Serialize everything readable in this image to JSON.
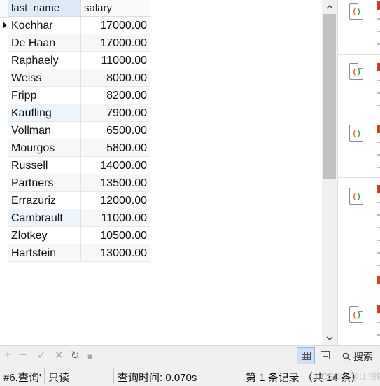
{
  "grid": {
    "columns": [
      "last_name",
      "salary"
    ],
    "rows": [
      [
        "Kochhar",
        "17000.00"
      ],
      [
        "De Haan",
        "17000.00"
      ],
      [
        "Raphaely",
        "11000.00"
      ],
      [
        "Weiss",
        "8000.00"
      ],
      [
        "Fripp",
        "8200.00"
      ],
      [
        "Kaufling",
        "7900.00"
      ],
      [
        "Vollman",
        "6500.00"
      ],
      [
        "Mourgos",
        "5800.00"
      ],
      [
        "Russell",
        "14000.00"
      ],
      [
        "Partners",
        "13500.00"
      ],
      [
        "Errazuriz",
        "12000.00"
      ],
      [
        "Cambrault",
        "11000.00"
      ],
      [
        "Zlotkey",
        "10500.00"
      ],
      [
        "Hartstein",
        "13000.00"
      ]
    ]
  },
  "scrollbar": {
    "up_glyph": "^",
    "down_glyph": "v"
  },
  "toolbar": {
    "add": "+",
    "remove": "−",
    "apply": "✓",
    "discard": "✕",
    "refresh": "↻",
    "stop": "■",
    "search_icon": "🔍",
    "search_label": "搜索"
  },
  "status": {
    "query_tab": "#6.查询'",
    "readonly": "只读",
    "query_time": "查询时间: 0.070s",
    "record_info": "第 1 条记录 （共 14 条）"
  },
  "watermark": "CSDN @江博R",
  "colors": {
    "accent": "#cfe0f4",
    "icon_orange": "#e06b2a",
    "icon_green": "#36a24a"
  }
}
